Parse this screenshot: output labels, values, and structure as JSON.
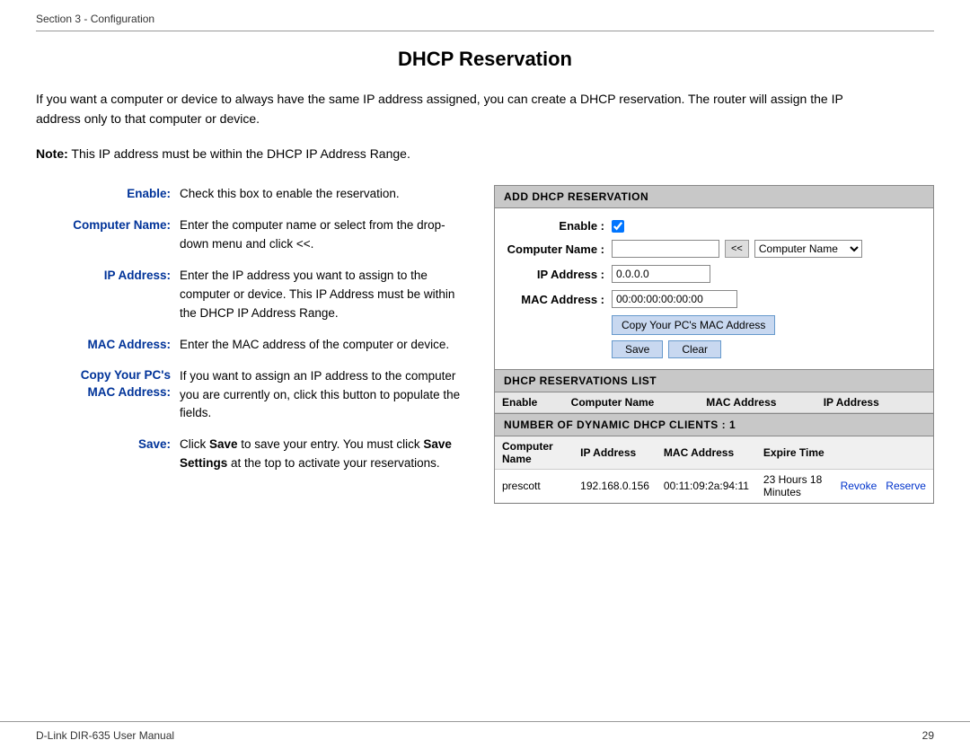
{
  "section_label": "Section 3 - Configuration",
  "page_title": "DHCP Reservation",
  "intro_text": "If you want a computer or device to always have the same IP address assigned, you can create a DHCP reservation. The router will assign the IP address only to that computer or device.",
  "note_text": "This IP address must be within the DHCP IP Address Range.",
  "note_prefix": "Note:",
  "descriptions": [
    {
      "label": "Enable:",
      "content": "Check this box to enable the reservation."
    },
    {
      "label": "Computer Name:",
      "content": "Enter the computer name or select from the drop-down menu and click <<."
    },
    {
      "label": "IP Address:",
      "content": "Enter the IP address you want to assign to the computer or device. This IP Address must be within the DHCP IP Address Range."
    },
    {
      "label": "MAC Address:",
      "content": "Enter the MAC address of the computer or device."
    },
    {
      "label": "Copy Your PC's MAC Address:",
      "content": "If you want to assign an IP address to the computer you are currently on, click this button to populate the fields."
    },
    {
      "label": "Save:",
      "content_parts": [
        "Click ",
        "Save",
        " to save your entry. You must click ",
        "Save Settings",
        " at the top to activate your reservations."
      ]
    }
  ],
  "panel": {
    "add_header": "ADD DHCP RESERVATION",
    "enable_label": "Enable :",
    "computer_name_label": "Computer Name :",
    "computer_name_value": "",
    "computer_name_placeholder": "",
    "chevron_label": "<<",
    "dropdown_value": "Computer Name",
    "ip_address_label": "IP Address :",
    "ip_address_value": "0.0.0.0",
    "mac_address_label": "MAC Address :",
    "mac_address_value": "00:00:00:00:00:00",
    "copy_mac_btn": "Copy Your PC's MAC Address",
    "save_btn": "Save",
    "clear_btn": "Clear",
    "reservations_header": "DHCP RESERVATIONS LIST",
    "reservations_columns": [
      "Enable",
      "Computer Name",
      "MAC Address",
      "IP Address"
    ],
    "dynamic_header": "NUMBER OF DYNAMIC DHCP CLIENTS : 1",
    "dynamic_columns": [
      "Computer Name",
      "IP Address",
      "MAC Address",
      "Expire Time"
    ],
    "dynamic_rows": [
      {
        "computer_name": "prescott",
        "ip_address": "192.168.0.156",
        "mac_address": "00:11:09:2a:94:11",
        "expire_time": "23 Hours 18 Minutes",
        "revoke_link": "Revoke",
        "reserve_link": "Reserve"
      }
    ]
  },
  "footer": {
    "left": "D-Link DIR-635 User Manual",
    "right": "29"
  }
}
